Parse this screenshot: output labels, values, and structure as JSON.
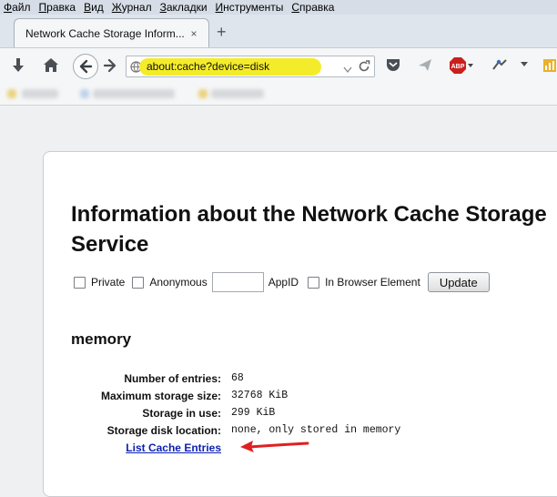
{
  "menu": [
    {
      "label": "Файл",
      "accel": 0
    },
    {
      "label": "Правка",
      "accel": 0
    },
    {
      "label": "Вид",
      "accel": 0
    },
    {
      "label": "Журнал",
      "accel": 0
    },
    {
      "label": "Закладки",
      "accel": 0
    },
    {
      "label": "Инструменты",
      "accel": 0
    },
    {
      "label": "Справка",
      "accel": 0
    }
  ],
  "tab": {
    "title": "Network Cache Storage Inform...",
    "close": "×",
    "new_tab": "+"
  },
  "navbar": {
    "url": "about:cache?device=disk",
    "abp_label": "ABP",
    "highlight_color": "#f4ec2a",
    "icons": [
      "download-icon",
      "home-icon",
      "back-icon",
      "forward-icon",
      "globe-icon",
      "dropdown-icon",
      "reload-icon",
      "pocket-icon",
      "send-icon",
      "adblock-icon",
      "plugin-icon",
      "menu-dropdown-icon",
      "bookmark-icon"
    ]
  },
  "page": {
    "title": "Information about the Network Cache Storage Service",
    "controls": {
      "private_label": "Private",
      "anonymous_label": "Anonymous",
      "appid_value": "",
      "appid_label": "AppID",
      "in_browser_label": "In Browser Element",
      "update_label": "Update"
    },
    "section": "memory",
    "rows": [
      {
        "key": "Number of entries:",
        "value": "68"
      },
      {
        "key": "Maximum storage size:",
        "value": "32768 KiB"
      },
      {
        "key": "Storage in use:",
        "value": "299 KiB"
      },
      {
        "key": "Storage disk location:",
        "value": "none, only stored in memory"
      }
    ],
    "list_link": "List Cache Entries",
    "arrow_color": "#e02020"
  }
}
